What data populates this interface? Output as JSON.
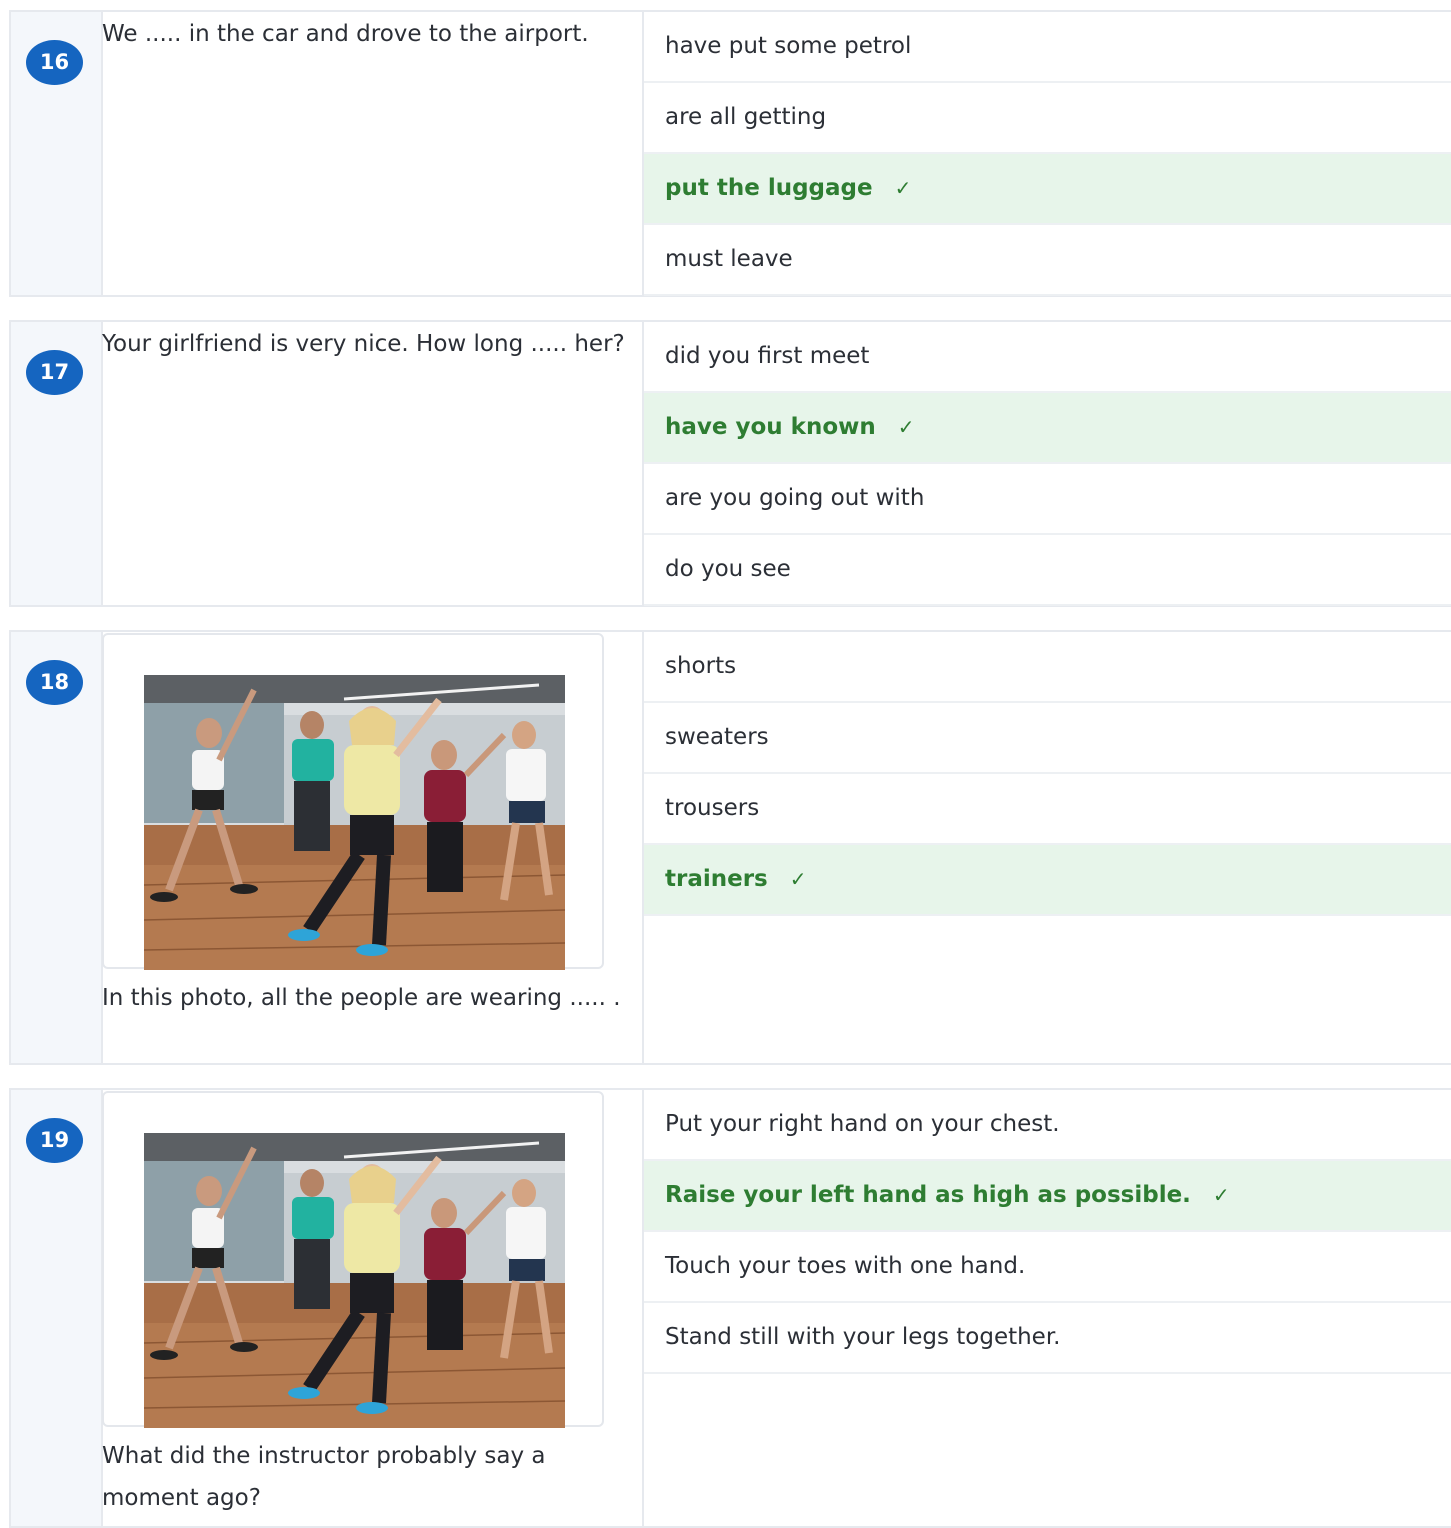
{
  "questions": [
    {
      "number": "16",
      "prompt": "We ..... in the car and drove to the airport.",
      "has_image": false,
      "answers": [
        {
          "text": "have put some petrol",
          "correct": false
        },
        {
          "text": "are all getting",
          "correct": false
        },
        {
          "text": "put the luggage",
          "correct": true
        },
        {
          "text": "must leave",
          "correct": false
        }
      ]
    },
    {
      "number": "17",
      "prompt": "Your girlfriend is very nice. How long ..... her?",
      "has_image": false,
      "answers": [
        {
          "text": "did you first meet",
          "correct": false
        },
        {
          "text": "have you known",
          "correct": true
        },
        {
          "text": "are you going out with",
          "correct": false
        },
        {
          "text": "do you see",
          "correct": false
        }
      ]
    },
    {
      "number": "18",
      "prompt": "In this photo, all the people are wearing ..... .",
      "has_image": true,
      "image_alt": "dance-class-photo",
      "answers": [
        {
          "text": "shorts",
          "correct": false
        },
        {
          "text": "sweaters",
          "correct": false
        },
        {
          "text": "trousers",
          "correct": false
        },
        {
          "text": "trainers",
          "correct": true
        }
      ]
    },
    {
      "number": "19",
      "prompt": "What did the instructor probably say a moment ago?",
      "has_image": true,
      "image_alt": "dance-class-photo",
      "answers": [
        {
          "text": "Put your right hand on your chest.",
          "correct": false
        },
        {
          "text": "Raise your left hand as high as possible.",
          "correct": true
        },
        {
          "text": "Touch your toes with one hand.",
          "correct": false
        },
        {
          "text": "Stand still with your legs together.",
          "correct": false
        }
      ]
    }
  ],
  "correct_mark": "✓",
  "colors": {
    "number_badge": "#1565c0",
    "correct_bg": "#e7f5ea",
    "correct_text": "#2e7d32",
    "number_column_bg": "#f4f7fb"
  }
}
